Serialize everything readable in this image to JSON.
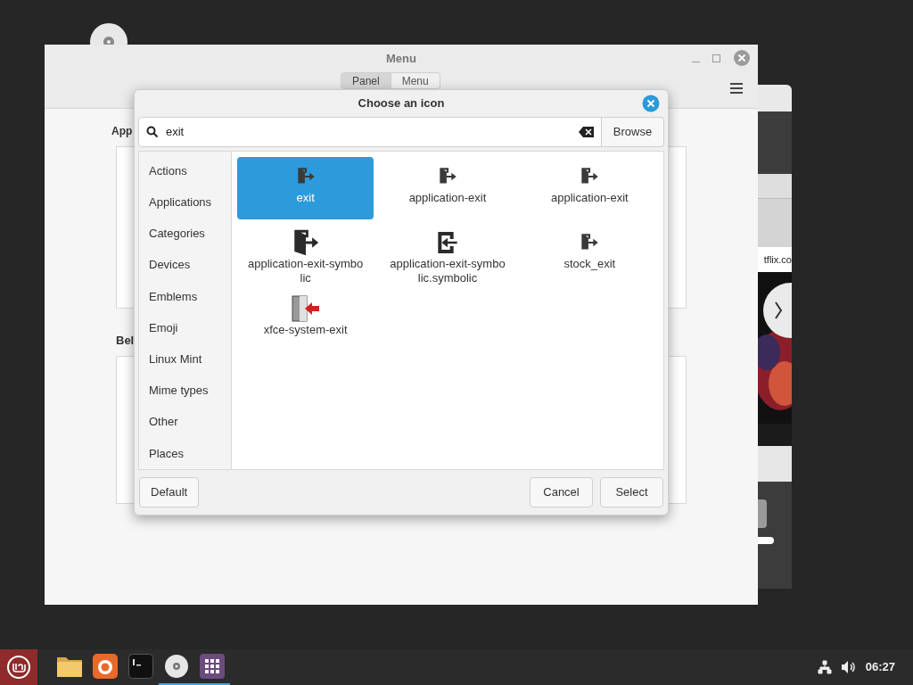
{
  "background_window": {
    "address_fragment": "tflix.co"
  },
  "menu_window": {
    "title": "Menu",
    "tabs": [
      {
        "label": "Panel",
        "selected": true
      },
      {
        "label": "Menu",
        "selected": false
      }
    ],
    "section_headings": [
      "App",
      "Bel"
    ]
  },
  "dialog": {
    "title": "Choose an icon",
    "search": {
      "value": "exit"
    },
    "browse": "Browse",
    "categories": [
      "Actions",
      "Applications",
      "Categories",
      "Devices",
      "Emblems",
      "Emoji",
      "Linux Mint",
      "Mime types",
      "Other",
      "Places"
    ],
    "icons": [
      {
        "label": "exit",
        "kind": "door",
        "selected": true
      },
      {
        "label": "application-exit",
        "kind": "door",
        "selected": false
      },
      {
        "label": "application-exit",
        "kind": "door",
        "selected": false
      },
      {
        "label": "application-exit-symbolic",
        "kind": "door-large",
        "selected": false
      },
      {
        "label": "application-exit-symbolic.symbolic",
        "kind": "enter",
        "selected": false
      },
      {
        "label": "stock_exit",
        "kind": "door",
        "selected": false
      },
      {
        "label": "xfce-system-exit",
        "kind": "red-arrow",
        "selected": false
      }
    ],
    "buttons": {
      "default": "Default",
      "cancel": "Cancel",
      "select": "Select"
    }
  },
  "taskbar": {
    "launchers": [
      {
        "kind": "folder",
        "running": false
      },
      {
        "kind": "firefox",
        "running": false
      },
      {
        "kind": "terminal",
        "running": false
      },
      {
        "kind": "disc",
        "running": true
      },
      {
        "kind": "apps",
        "running": true
      }
    ],
    "clock": "06:27"
  }
}
